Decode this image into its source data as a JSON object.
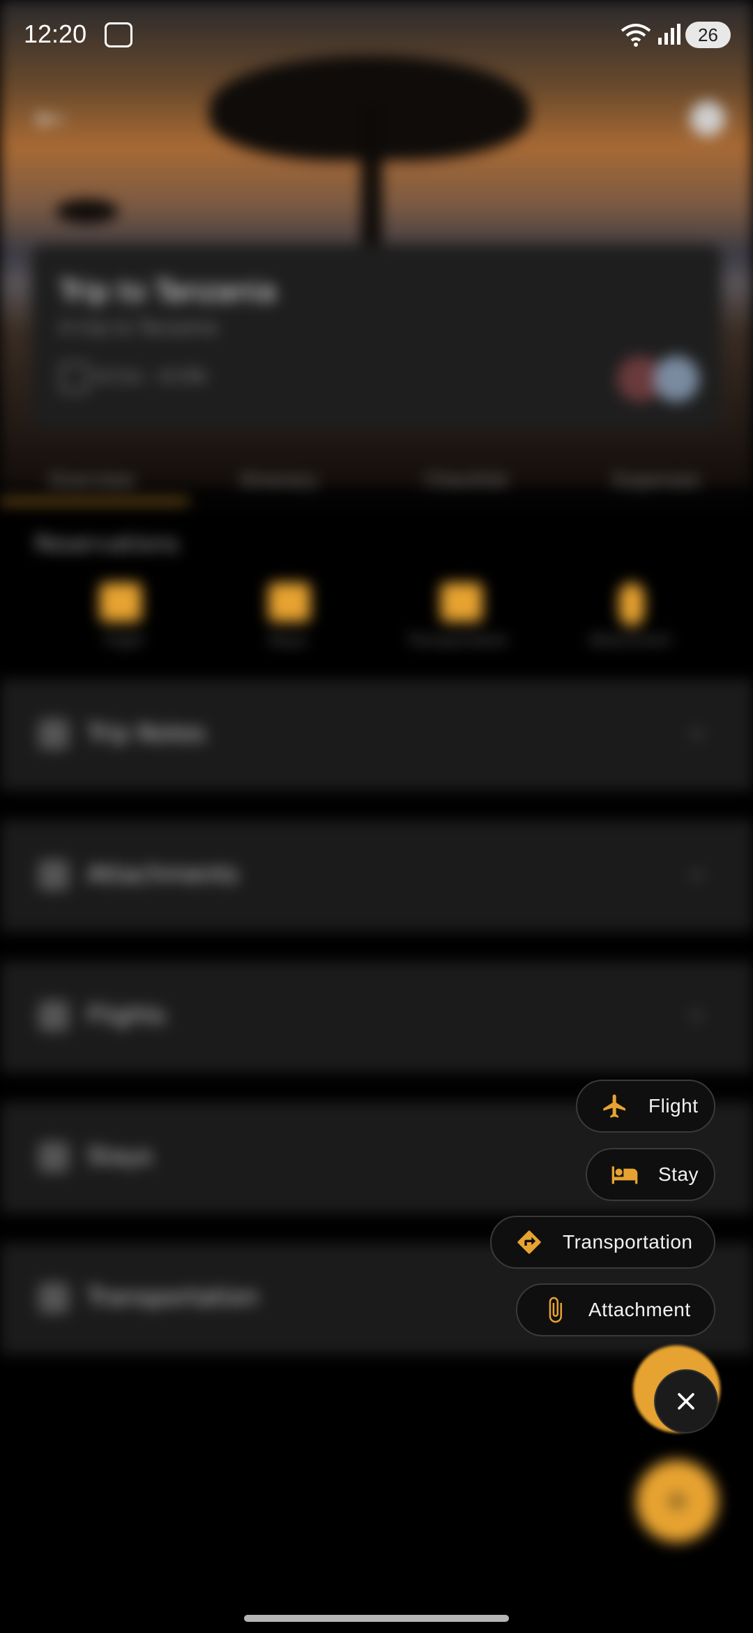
{
  "status_bar": {
    "time": "12:20",
    "battery": "26"
  },
  "trip": {
    "title": "Trip to Tanzania",
    "subtitle": "A trip to Tanzania",
    "dates": "4/12a - 4/19b"
  },
  "tabs": [
    "Overview",
    "Itinerary",
    "Checklist",
    "Expenses"
  ],
  "reservations": {
    "title": "Reservations",
    "items": [
      {
        "label": "Flight"
      },
      {
        "label": "Stays"
      },
      {
        "label": "Transportation"
      },
      {
        "label": "Attachment"
      }
    ]
  },
  "sections": [
    {
      "title": "Trip Notes"
    },
    {
      "title": "Attachments"
    },
    {
      "title": "Flights"
    },
    {
      "title": "Stays"
    },
    {
      "title": "Transportation"
    }
  ],
  "speed_dial": {
    "flight": "Flight",
    "stay": "Stay",
    "transportation": "Transportation",
    "attachment": "Attachment"
  },
  "colors": {
    "accent": "#e7a331",
    "background": "#000000",
    "chip_bg": "#0f0f0f"
  }
}
